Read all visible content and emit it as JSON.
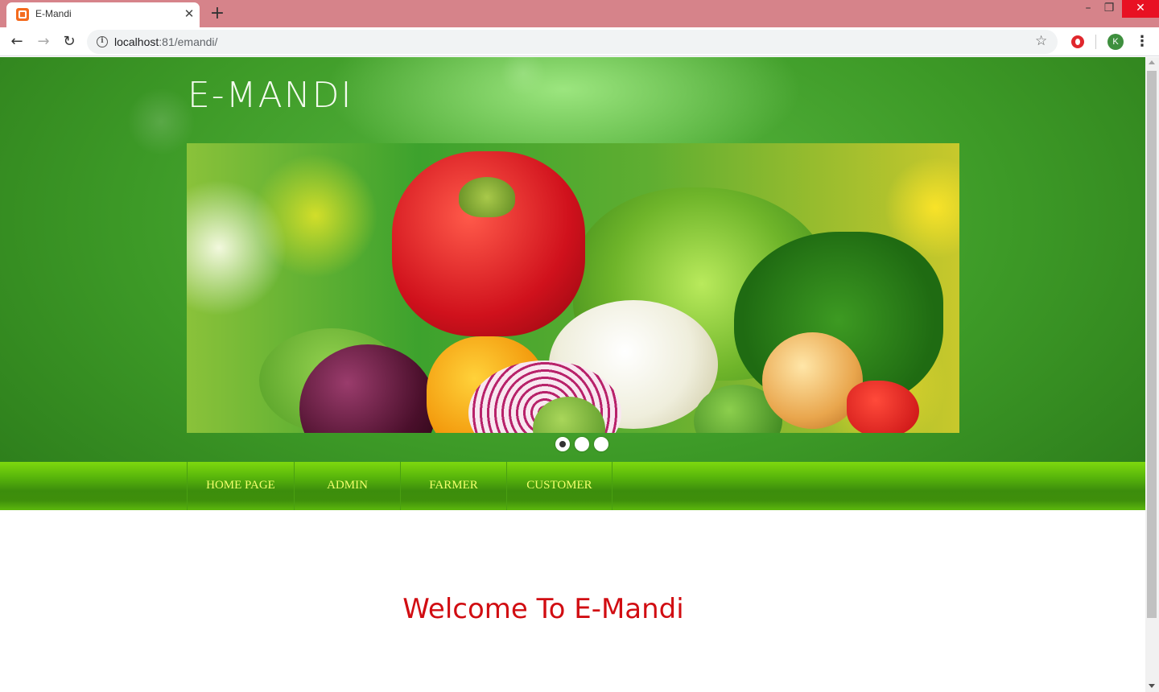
{
  "browser": {
    "tab_title": "E-Mandi",
    "url_host": "localhost",
    "url_path": ":81/emandi/",
    "profile_initial": "K"
  },
  "site": {
    "title": "E-MANDI",
    "slider": {
      "slide_count": 3,
      "active_slide": 1
    },
    "nav": [
      {
        "label": "HOME PAGE"
      },
      {
        "label": "ADMIN"
      },
      {
        "label": "FARMER"
      },
      {
        "label": "CUSTOMER"
      }
    ],
    "welcome": "Welcome To E-Mandi"
  },
  "colors": {
    "header_green": "#3d9a27",
    "nav_green": "#5ab80b",
    "nav_text": "#f2ff6d",
    "welcome_red": "#d10d12",
    "titlebar": "#d6838a"
  }
}
